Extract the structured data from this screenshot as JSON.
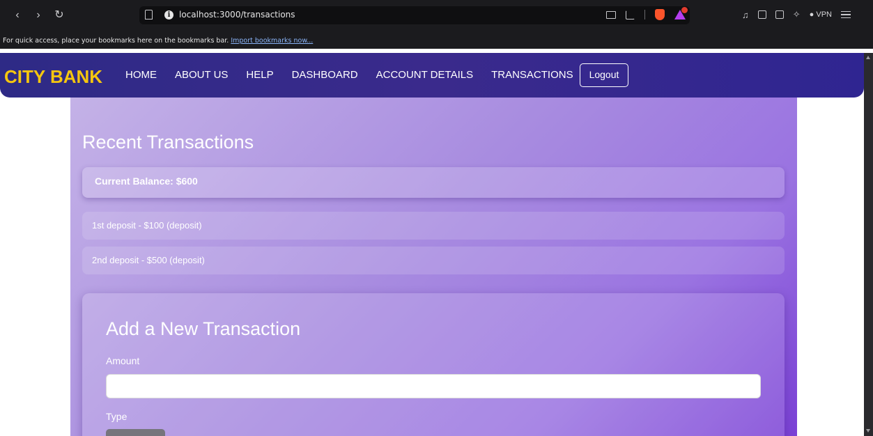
{
  "browser": {
    "nav": {
      "back": "‹",
      "forward": "›",
      "reload": "↻"
    },
    "url": "localhost:3000/transactions",
    "vpn_label": "VPN",
    "bookmarks_message": "For quick access, place your bookmarks here on the bookmarks bar.",
    "bookmarks_link": "Import bookmarks now..."
  },
  "site": {
    "logo": "CITY BANK",
    "menu": [
      "HOME",
      "ABOUT US",
      "HELP",
      "DASHBOARD",
      "ACCOUNT DETAILS",
      "TRANSACTIONS"
    ],
    "logout": "Logout"
  },
  "transactions_page": {
    "title": "Recent Transactions",
    "current_balance": "Current Balance: $600",
    "transactions": [
      "1st deposit - $100 (deposit)",
      "2nd deposit - $500 (deposit)"
    ]
  },
  "form": {
    "title": "Add a New Transaction",
    "amount_label": "Amount",
    "amount_value": "",
    "type_label": "Type"
  },
  "colors": {
    "logo": "#f5c60f",
    "nav_background": "#2e2a86",
    "container_gradient_start": "#c4b2e7",
    "container_gradient_end": "#7b41d6"
  }
}
